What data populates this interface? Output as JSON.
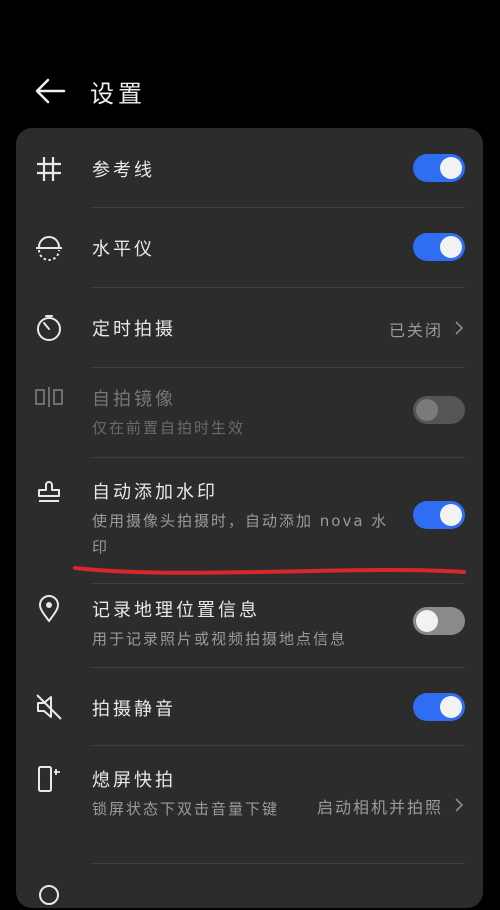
{
  "header": {
    "title": "设置"
  },
  "settings": {
    "gridlines": {
      "label": "参考线",
      "on": true
    },
    "level": {
      "label": "水平仪",
      "on": true
    },
    "timer": {
      "label": "定时拍摄",
      "value": "已关闭"
    },
    "mirror": {
      "label": "自拍镜像",
      "desc": "仅在前置自拍时生效",
      "on": false,
      "enabled": false
    },
    "watermark": {
      "label": "自动添加水印",
      "desc": "使用摄像头拍摄时，自动添加 nova 水印",
      "on": true
    },
    "location": {
      "label": "记录地理位置信息",
      "desc": "用于记录照片或视频拍摄地点信息",
      "on": false
    },
    "mute": {
      "label": "拍摄静音",
      "on": true
    },
    "snapshot": {
      "label": "熄屏快拍",
      "desc": "锁屏状态下双击音量下键",
      "value": "启动相机并拍照"
    }
  },
  "colors": {
    "accent": "#2f6ef3",
    "annotation": "#d8262a"
  }
}
